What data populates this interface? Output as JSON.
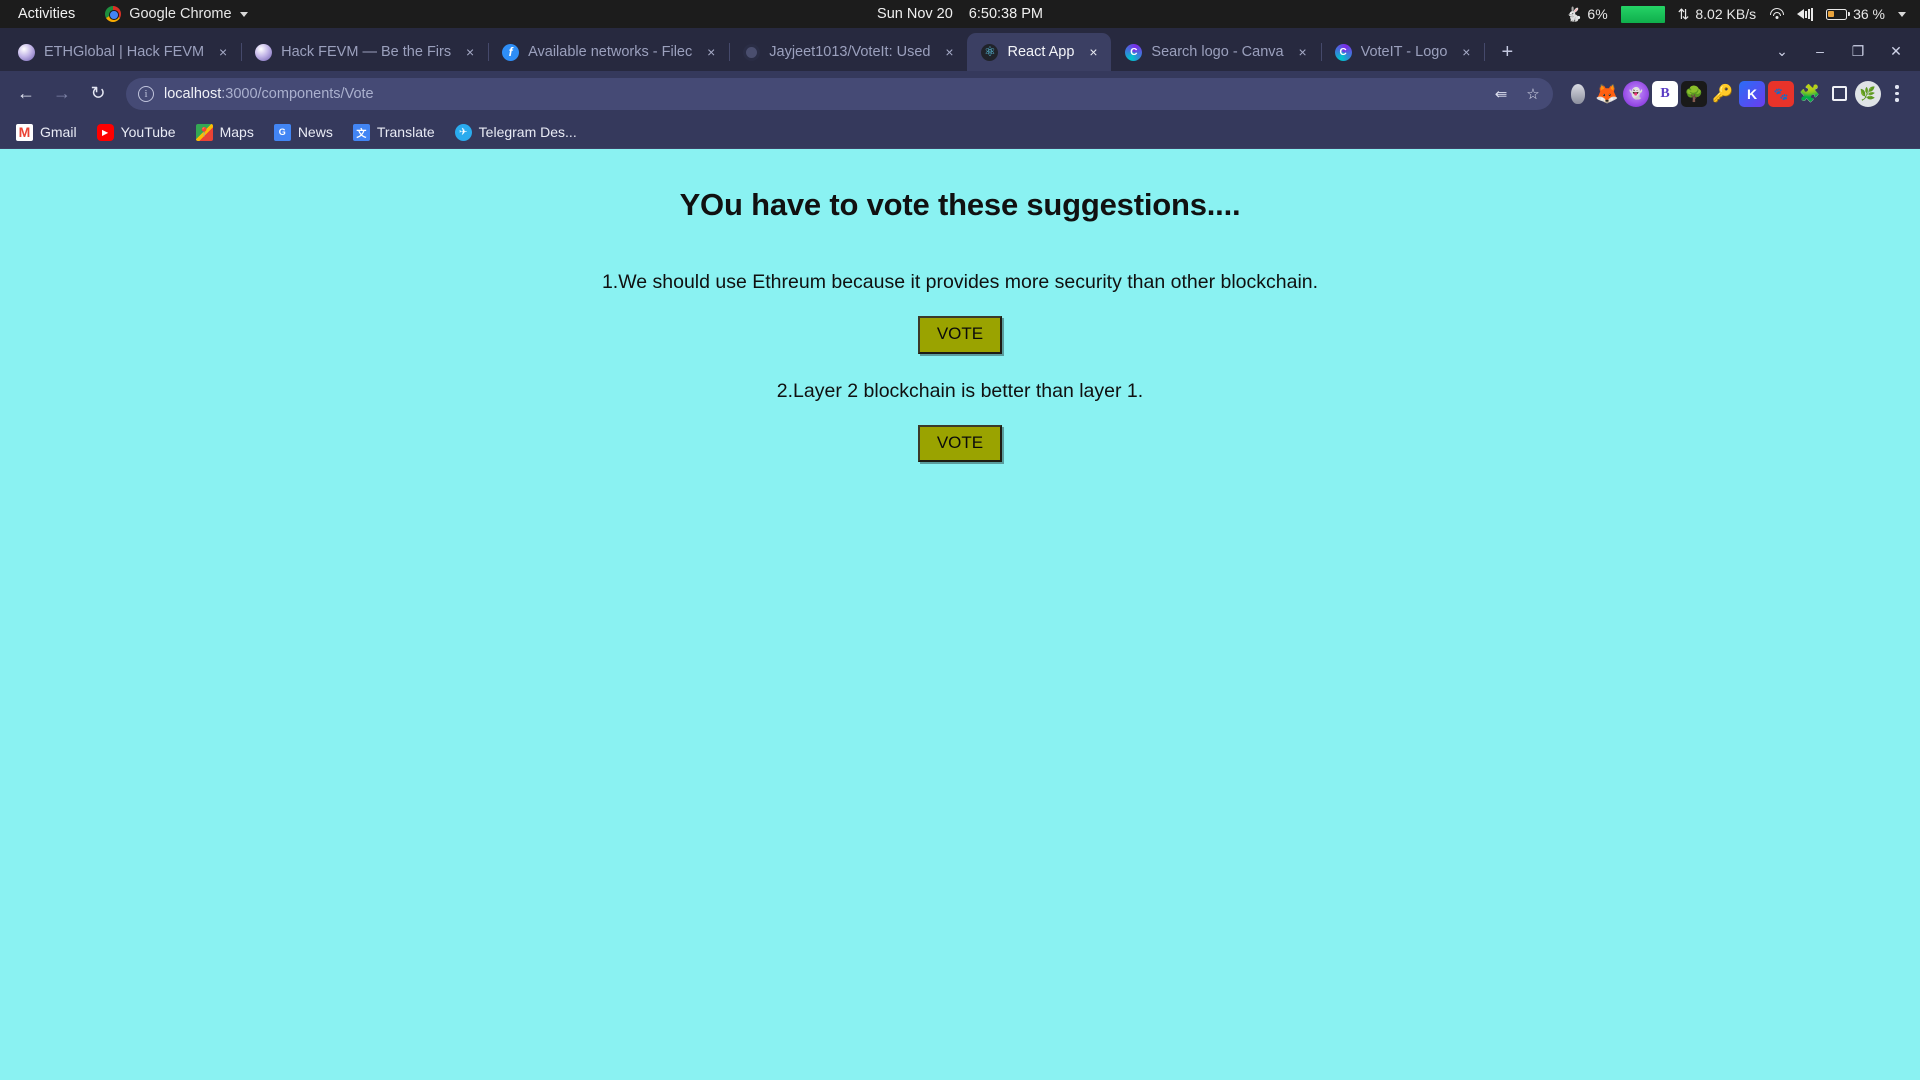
{
  "gnome": {
    "activities": "Activities",
    "app_menu": "Google Chrome",
    "app_icon": "chrome-icon",
    "date": "Sun Nov 20",
    "time": "6:50:38 PM",
    "cpu_icon": "cheetah-icon",
    "cpu_percent": "6%",
    "net_speed": "8.02 KB/s",
    "net_icon": "network-updown-icon",
    "wifi_icon": "wifi-icon",
    "volume_icon": "volume-icon",
    "battery_icon": "battery-icon",
    "battery_percent": "36 %",
    "menu_caret": "chevron-down-icon"
  },
  "browser": {
    "tabs": [
      {
        "title": "ETHGlobal | Hack FEVM",
        "favicon": "ethglobal-icon",
        "active": false
      },
      {
        "title": "Hack FEVM — Be the Firs",
        "favicon": "ethglobal-icon",
        "active": false
      },
      {
        "title": "Available networks - Filec",
        "favicon": "filecoin-icon",
        "active": false
      },
      {
        "title": "Jayjeet1013/VoteIt: Used",
        "favicon": "github-icon",
        "active": false
      },
      {
        "title": "React App",
        "favicon": "react-icon",
        "active": true
      },
      {
        "title": "Search logo - Canva",
        "favicon": "canva-icon",
        "active": false
      },
      {
        "title": "VoteIT - Logo",
        "favicon": "canva-icon",
        "active": false
      }
    ],
    "tab_close_label": "×",
    "new_tab_label": "+",
    "tab_search_label": "⌄",
    "window_minimize": "–",
    "window_maximize": "❐",
    "window_close": "✕",
    "back_label": "←",
    "forward_label": "→",
    "reload_label": "↻",
    "site_info_label": "i",
    "url_host": "localhost",
    "url_path": ":3000/components/Vote",
    "share_label": "‹",
    "bookmark_star_label": "☆",
    "extensions": [
      "pipette-icon",
      "metamask-fox-icon",
      "ghost-icon",
      "bitwarden-b-icon",
      "tree-icon",
      "key-icon",
      "kite-k-icon",
      "paw-red-icon",
      "puzzle-extensions-icon",
      "sidepanel-icon"
    ],
    "profile_avatar": "user-avatar",
    "menu_label": "kebab-menu-icon",
    "bookmarks": [
      {
        "label": "Gmail",
        "icon": "gmail-icon"
      },
      {
        "label": "YouTube",
        "icon": "youtube-icon"
      },
      {
        "label": "Maps",
        "icon": "maps-icon"
      },
      {
        "label": "News",
        "icon": "news-icon"
      },
      {
        "label": "Translate",
        "icon": "translate-icon"
      },
      {
        "label": "Telegram Des...",
        "icon": "telegram-icon"
      }
    ]
  },
  "page": {
    "background_color": "#8af2f2",
    "title": "YOu have to vote these suggestions....",
    "button_color": "#9aa300",
    "suggestions": [
      {
        "text": "1.We should use Ethreum because it provides more security than other blockchain.",
        "vote_label": "VOTE"
      },
      {
        "text": "2.Layer 2 blockchain is better than layer 1.",
        "vote_label": "VOTE"
      }
    ]
  }
}
